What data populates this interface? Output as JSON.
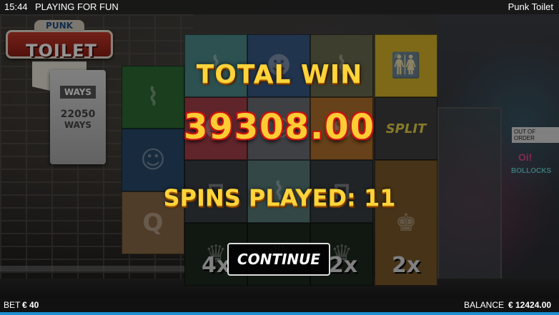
{
  "topbar": {
    "time": "15:44",
    "mode": "PLAYING FOR FUN",
    "game_title": "Punk Toilet"
  },
  "logo": {
    "top_text": "PUNK",
    "main_text": "TOILET"
  },
  "ways": {
    "badge": "WAYS",
    "count": "22050",
    "label": "WAYS"
  },
  "reels": {
    "multipliers": [
      "4x",
      "2x",
      "2x"
    ]
  },
  "signs": {
    "out_of_order": "OUT OF ORDER",
    "oi": "Oi!",
    "bollocks": "BOLLOCKS"
  },
  "popup": {
    "title": "TOTAL WIN",
    "amount": "39308.00",
    "spins_label": "SPINS PLAYED:",
    "spins_count": "11",
    "continue_label": "CONTINUE"
  },
  "bottombar": {
    "bet_label": "BET",
    "bet_value": "€ 40",
    "balance_label": "BALANCE",
    "balance_value": "€ 12424.00"
  },
  "colors": {
    "accent_gold": "#ffd43a",
    "amount_red_outline": "#c21414",
    "status_strip": "#1d8fd1"
  }
}
